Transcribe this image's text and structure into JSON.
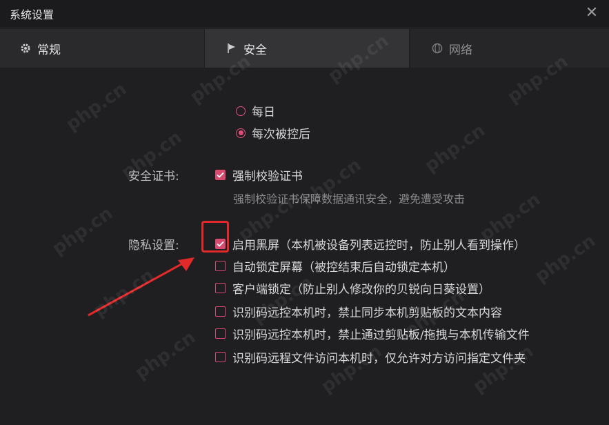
{
  "window": {
    "title": "系统设置",
    "close_icon": "close-icon"
  },
  "tabs": [
    {
      "label": "常规",
      "icon": "gear-icon"
    },
    {
      "label": "安全",
      "icon": "flag-icon"
    },
    {
      "label": "网络",
      "icon": "globe-icon"
    }
  ],
  "radios": [
    {
      "label": "每日",
      "checked": false
    },
    {
      "label": "每次被控后",
      "checked": true
    }
  ],
  "certificate": {
    "section_label": "安全证书:",
    "checkbox_label": "强制校验证书",
    "checked": true,
    "hint": "强制校验证书保障数据通讯安全，避免遭受攻击"
  },
  "privacy": {
    "section_label": "隐私设置:",
    "options": [
      {
        "label": "启用黑屏（本机被设备列表远控时，防止别人看到操作）",
        "checked": true
      },
      {
        "label": "自动锁定屏幕（被控结束后自动锁定本机）",
        "checked": false
      },
      {
        "label": "客户端锁定（防止别人修改你的贝锐向日葵设置）",
        "checked": false
      },
      {
        "label": "识别码远控本机时，禁止同步本机剪贴板的文本内容",
        "checked": false
      },
      {
        "label": "识别码远控本机时，禁止通过剪贴板/拖拽与本机传输文件",
        "checked": false
      },
      {
        "label": "识别码远程文件访问本机时，仅允许对方访问指定文件夹",
        "checked": false
      }
    ]
  },
  "colors": {
    "accent": "#d84b70",
    "annotation": "#e32a2a"
  },
  "watermark": "php.cn"
}
